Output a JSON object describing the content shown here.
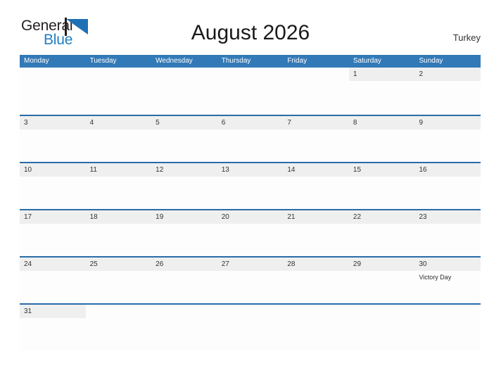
{
  "brand": {
    "name_part1": "General",
    "name_part2": "Blue",
    "flag_icon": "blue-triangle-flag-icon"
  },
  "header": {
    "title": "August 2026",
    "country": "Turkey"
  },
  "colors": {
    "header_blue": "#3279b8",
    "separator_blue": "#2a6ca8",
    "band_gray": "#efefef",
    "logo_blue": "#1f7fc4",
    "text_dark": "#333333"
  },
  "weekdays": [
    "Monday",
    "Tuesday",
    "Wednesday",
    "Thursday",
    "Friday",
    "Saturday",
    "Sunday"
  ],
  "weeks": [
    [
      {
        "day": "",
        "blank": true,
        "events": []
      },
      {
        "day": "",
        "blank": true,
        "events": []
      },
      {
        "day": "",
        "blank": true,
        "events": []
      },
      {
        "day": "",
        "blank": true,
        "events": []
      },
      {
        "day": "",
        "blank": true,
        "events": []
      },
      {
        "day": "1",
        "blank": false,
        "events": []
      },
      {
        "day": "2",
        "blank": false,
        "events": []
      }
    ],
    [
      {
        "day": "3",
        "blank": false,
        "events": []
      },
      {
        "day": "4",
        "blank": false,
        "events": []
      },
      {
        "day": "5",
        "blank": false,
        "events": []
      },
      {
        "day": "6",
        "blank": false,
        "events": []
      },
      {
        "day": "7",
        "blank": false,
        "events": []
      },
      {
        "day": "8",
        "blank": false,
        "events": []
      },
      {
        "day": "9",
        "blank": false,
        "events": []
      }
    ],
    [
      {
        "day": "10",
        "blank": false,
        "events": []
      },
      {
        "day": "11",
        "blank": false,
        "events": []
      },
      {
        "day": "12",
        "blank": false,
        "events": []
      },
      {
        "day": "13",
        "blank": false,
        "events": []
      },
      {
        "day": "14",
        "blank": false,
        "events": []
      },
      {
        "day": "15",
        "blank": false,
        "events": []
      },
      {
        "day": "16",
        "blank": false,
        "events": []
      }
    ],
    [
      {
        "day": "17",
        "blank": false,
        "events": []
      },
      {
        "day": "18",
        "blank": false,
        "events": []
      },
      {
        "day": "19",
        "blank": false,
        "events": []
      },
      {
        "day": "20",
        "blank": false,
        "events": []
      },
      {
        "day": "21",
        "blank": false,
        "events": []
      },
      {
        "day": "22",
        "blank": false,
        "events": []
      },
      {
        "day": "23",
        "blank": false,
        "events": []
      }
    ],
    [
      {
        "day": "24",
        "blank": false,
        "events": []
      },
      {
        "day": "25",
        "blank": false,
        "events": []
      },
      {
        "day": "26",
        "blank": false,
        "events": []
      },
      {
        "day": "27",
        "blank": false,
        "events": []
      },
      {
        "day": "28",
        "blank": false,
        "events": []
      },
      {
        "day": "29",
        "blank": false,
        "events": []
      },
      {
        "day": "30",
        "blank": false,
        "events": [
          "Victory Day"
        ]
      }
    ],
    [
      {
        "day": "31",
        "blank": false,
        "events": []
      },
      {
        "day": "",
        "blank": true,
        "events": []
      },
      {
        "day": "",
        "blank": true,
        "events": []
      },
      {
        "day": "",
        "blank": true,
        "events": []
      },
      {
        "day": "",
        "blank": true,
        "events": []
      },
      {
        "day": "",
        "blank": true,
        "events": []
      },
      {
        "day": "",
        "blank": true,
        "events": []
      }
    ]
  ]
}
